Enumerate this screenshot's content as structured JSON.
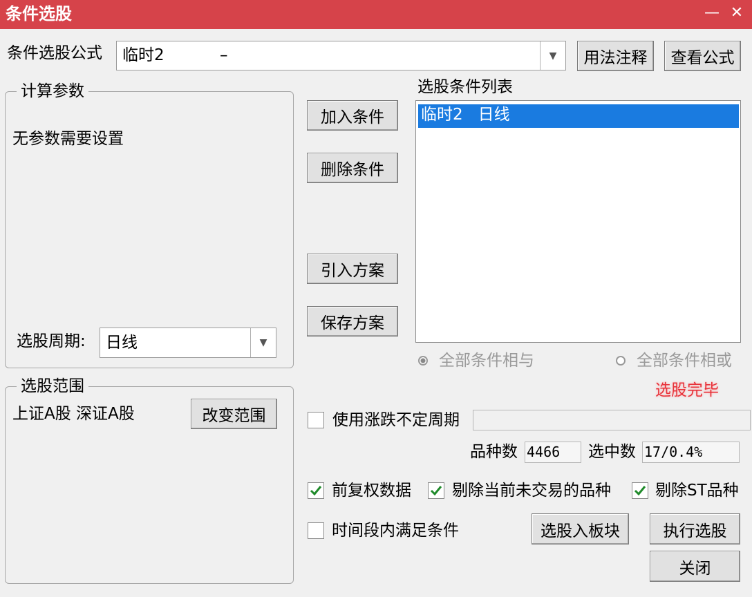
{
  "window": {
    "title": "条件选股",
    "minimize_glyph": "—",
    "close_glyph": "✕"
  },
  "formula": {
    "label": "条件选股公式",
    "value": "临时2           –",
    "usage_button": "用法注释",
    "view_button": "查看公式"
  },
  "params": {
    "legend": "计算参数",
    "message": "无参数需要设置",
    "period_label": "选股周期:",
    "period_value": "日线"
  },
  "actions": {
    "add": "加入条件",
    "delete": "删除条件",
    "import": "引入方案",
    "save": "保存方案"
  },
  "conditions": {
    "label": "选股条件列表",
    "items": [
      {
        "text": "临时2   日线",
        "selected": true
      }
    ]
  },
  "logic": {
    "and_label": "全部条件相与",
    "or_label": "全部条件相或",
    "and_selected": true
  },
  "status": {
    "text": "选股完毕",
    "color": "#e8323a"
  },
  "range": {
    "legend": "选股范围",
    "markets": "上证A股 深证A股",
    "change_button": "改变范围"
  },
  "period_option": {
    "label": "使用涨跌不定周期",
    "checked": false
  },
  "stats": {
    "count_label": "品种数",
    "count_value": "4466",
    "selected_label": "选中数",
    "selected_value": "17/0.4%"
  },
  "options": {
    "adjusted": {
      "label": "前复权数据",
      "checked": true
    },
    "exclude_untraded": {
      "label": "剔除当前未交易的品种",
      "checked": true
    },
    "exclude_st": {
      "label": "剔除ST品种",
      "checked": true
    },
    "time_range": {
      "label": "时间段内满足条件",
      "checked": false
    }
  },
  "bottom_buttons": {
    "to_block": "选股入板块",
    "execute": "执行选股",
    "close": "关闭"
  },
  "colors": {
    "titlebar": "#d6434a",
    "selection": "#1a7be0",
    "check": "#1f8a2a"
  }
}
